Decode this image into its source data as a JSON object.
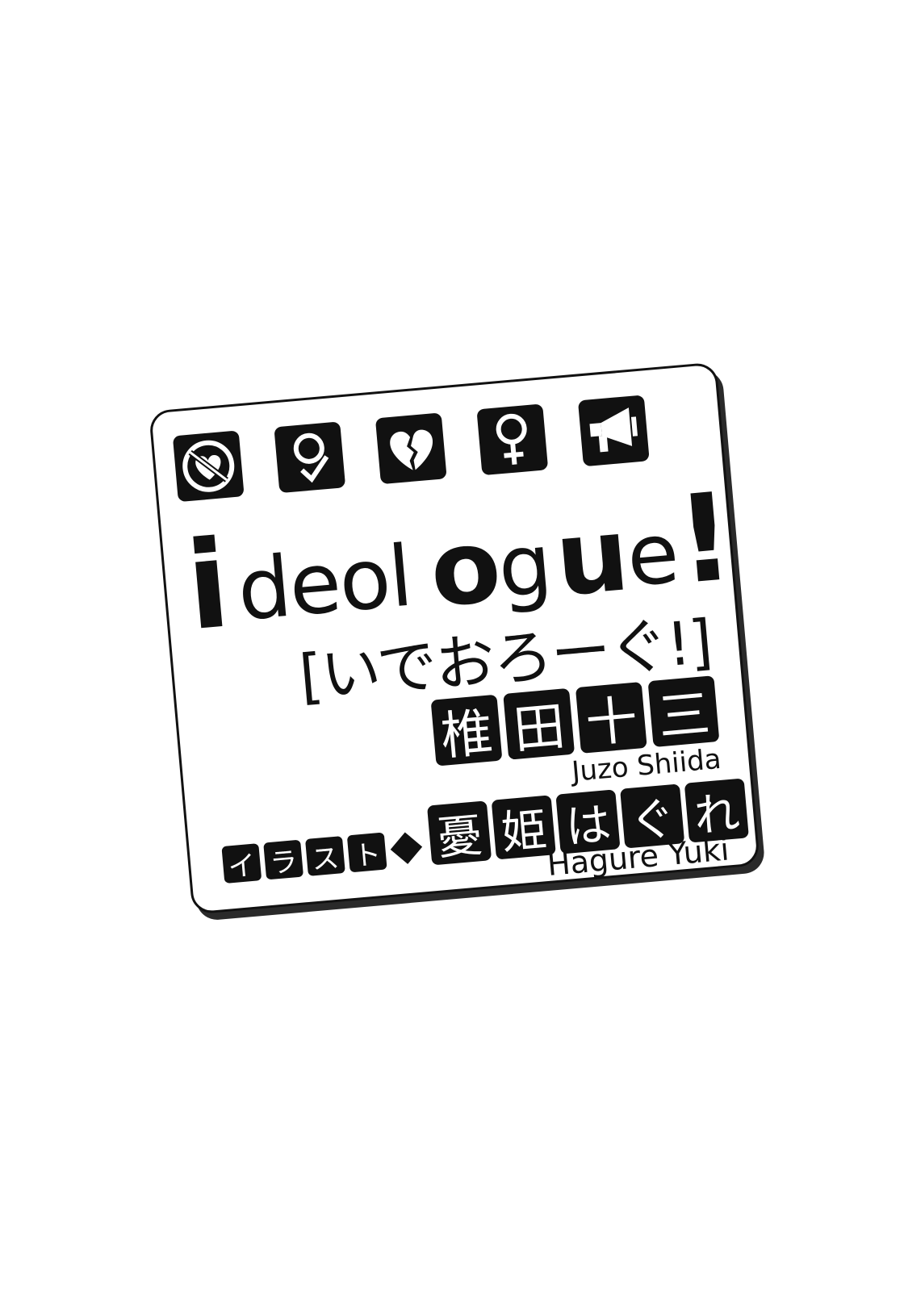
{
  "icons": [
    "no-heart-icon",
    "female-arrow-icon",
    "broken-heart-icon",
    "female-icon",
    "megaphone-icon"
  ],
  "title": {
    "seg_i": "i",
    "seg_deol": "deol",
    "seg_o": "o",
    "seg_g": "g",
    "seg_u": "u",
    "seg_e": "e",
    "seg_bang": "!"
  },
  "japanese_title": "[いでおろーぐ!]",
  "author": {
    "chars": [
      "椎",
      "田",
      "十",
      "三"
    ],
    "romaji": "Juzo Shiida"
  },
  "illustrator": {
    "label_chars": [
      "イ",
      "ラ",
      "ス",
      "ト"
    ],
    "chars": [
      "憂",
      "姫",
      "は",
      "ぐ",
      "れ"
    ],
    "romaji": "Hagure Yuki"
  },
  "colors": {
    "ink": "#111111",
    "paper": "#ffffff"
  }
}
